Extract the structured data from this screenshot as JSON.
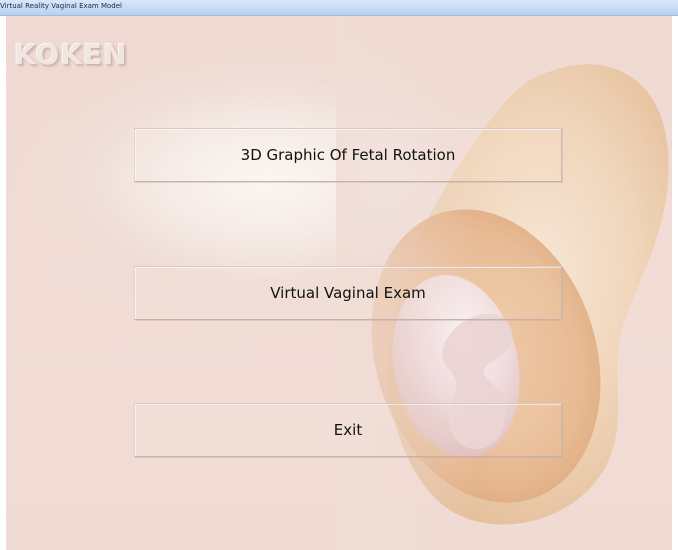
{
  "window": {
    "title": "Virtual Reality Vaginal Exam Model"
  },
  "logo": {
    "text": "KOKEN"
  },
  "menu": {
    "fetal_rotation_label": "3D Graphic Of Fetal Rotation",
    "vaginal_exam_label": "Virtual Vaginal Exam",
    "exit_label": "Exit"
  },
  "colors": {
    "background": "#efdcd5",
    "uterus_shape": "#e6c29c",
    "titlebar": "#c8dcf4",
    "button_text": "#111111"
  }
}
